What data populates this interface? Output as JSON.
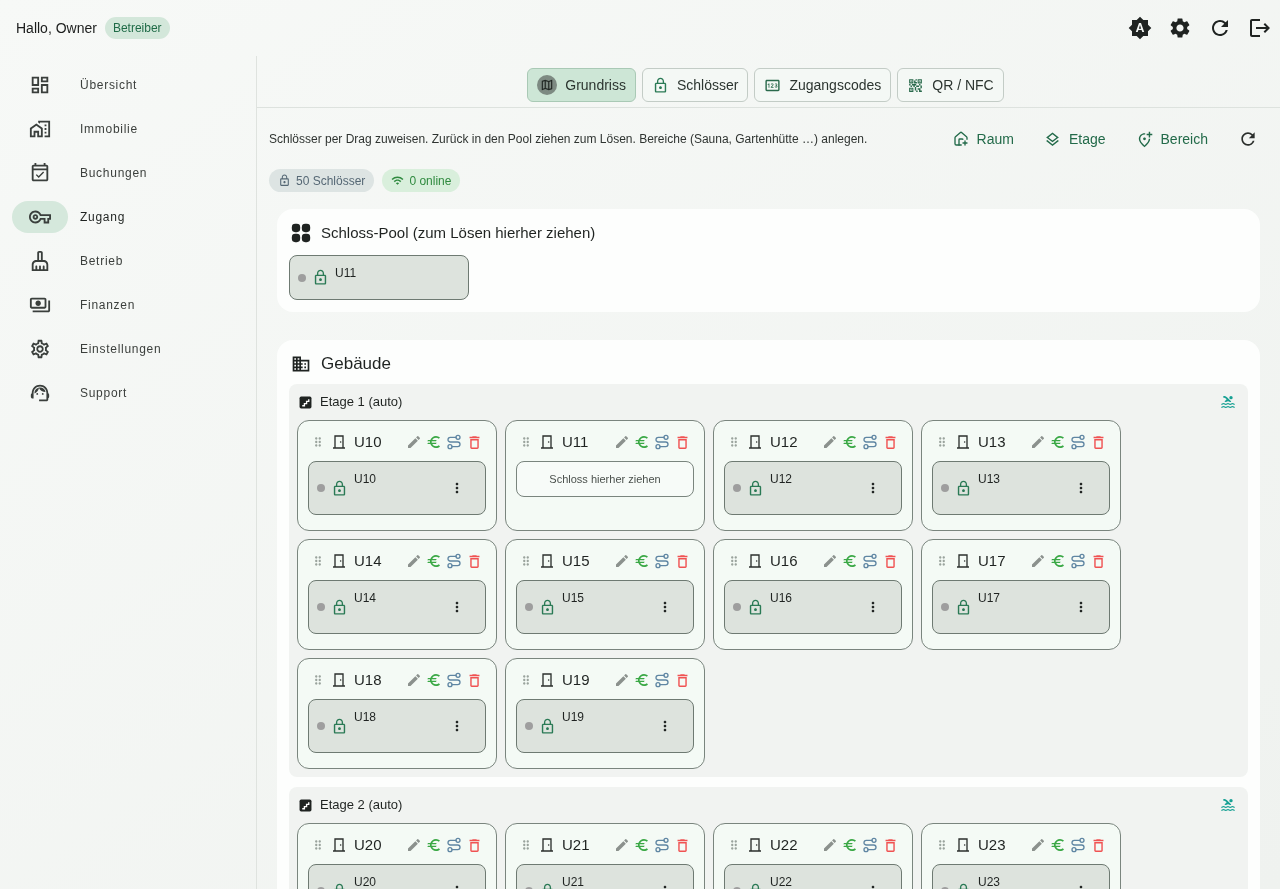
{
  "header": {
    "greeting": "Hallo, Owner",
    "role": "Betreiber"
  },
  "sidebar": {
    "items": [
      {
        "label": "Übersicht",
        "selected": false
      },
      {
        "label": "Immobilie",
        "selected": false
      },
      {
        "label": "Buchungen",
        "selected": false
      },
      {
        "label": "Zugang",
        "selected": true
      },
      {
        "label": "Betrieb",
        "selected": false
      },
      {
        "label": "Finanzen",
        "selected": false
      },
      {
        "label": "Einstellungen",
        "selected": false
      },
      {
        "label": "Support",
        "selected": false
      }
    ]
  },
  "tabs": [
    {
      "label": "Grundriss",
      "selected": true
    },
    {
      "label": "Schlösser",
      "selected": false
    },
    {
      "label": "Zugangscodes",
      "selected": false
    },
    {
      "label": "QR / NFC",
      "selected": false
    }
  ],
  "hint": "Schlösser per Drag zuweisen. Zurück in den Pool ziehen zum Lösen. Bereiche (Sauna, Gartenhütte …) anlegen.",
  "actions": [
    {
      "label": "Raum"
    },
    {
      "label": "Etage"
    },
    {
      "label": "Bereich"
    }
  ],
  "stats": [
    {
      "label": "50 Schlösser",
      "kind": "locks"
    },
    {
      "label": "0 online",
      "kind": "online"
    }
  ],
  "pool": {
    "title": "Schloss-Pool (zum Lösen hierher ziehen)",
    "locks": [
      {
        "name": "U11",
        "online": false
      }
    ]
  },
  "building": {
    "title": "Gebäude",
    "floors": [
      {
        "title": "Etage 1 (auto)",
        "rooms": [
          {
            "name": "U10",
            "lock": {
              "name": "U10",
              "online": false
            }
          },
          {
            "name": "U11",
            "empty_hint": "Schloss hierher ziehen"
          },
          {
            "name": "U12",
            "lock": {
              "name": "U12",
              "online": false
            }
          },
          {
            "name": "U13",
            "lock": {
              "name": "U13",
              "online": false
            }
          },
          {
            "name": "U14",
            "lock": {
              "name": "U14",
              "online": false
            }
          },
          {
            "name": "U15",
            "lock": {
              "name": "U15",
              "online": false
            }
          },
          {
            "name": "U16",
            "lock": {
              "name": "U16",
              "online": false
            }
          },
          {
            "name": "U17",
            "lock": {
              "name": "U17",
              "online": false
            }
          },
          {
            "name": "U18",
            "lock": {
              "name": "U18",
              "online": false
            }
          },
          {
            "name": "U19",
            "lock": {
              "name": "U19",
              "online": false
            }
          }
        ]
      },
      {
        "title": "Etage 2 (auto)",
        "rooms": [
          {
            "name": "U20",
            "lock": {
              "name": "U20",
              "online": false
            }
          },
          {
            "name": "U21",
            "lock": {
              "name": "U21",
              "online": false
            }
          },
          {
            "name": "U22",
            "lock": {
              "name": "U22",
              "online": false
            }
          },
          {
            "name": "U23",
            "lock": {
              "name": "U23",
              "online": false
            }
          }
        ]
      }
    ]
  }
}
